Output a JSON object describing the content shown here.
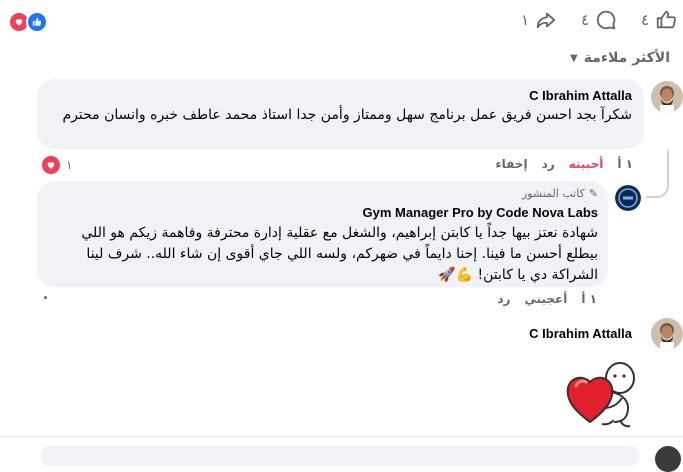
{
  "colors": {
    "brand": "#1877f2",
    "love": "#f33e58",
    "muted": "#65676b",
    "bubble": "#f0f2f5"
  },
  "action_bar": {
    "like_count": "٤",
    "comment_count": "٤",
    "share_count": "١",
    "icons": [
      "thumbs-up-icon",
      "comment-icon",
      "share-icon"
    ],
    "reactions": [
      "like-reaction-icon",
      "love-reaction-icon"
    ]
  },
  "sort": {
    "label": "الأكثر ملاءمة"
  },
  "comments": [
    {
      "author": "C Ibrahim Attalla",
      "text": "شكرآ بجد احسن فريق عمل برنامج سهل وممتاز وأمن جدا استاذ محمد عاطف خبره وانسان محترم",
      "time": "١ أ",
      "love_label": "أحببته",
      "reply_label": "رد",
      "hide_label": "إخفاء",
      "reaction_count": "١"
    }
  ],
  "reply": {
    "badge": "كاتب المنشور",
    "author": "Gym Manager Pro by Code Nova Labs",
    "text": "شهادة نعتز بيها جداً يا كابتن إبراهيم، والشغل مع عقلية إدارة محترفة وفاهمة زيكم هو اللي بيطلع أحسن ما فينا. إحنا دايماً في ضهركم، ولسه اللي جاي أقوى إن شاء الله.. شرف لينا الشراكة دي يا كابتن! 💪🚀",
    "time": "١ أ",
    "like_label": "أعجبني",
    "reply_label": "رد"
  },
  "second_comment": {
    "author": "C Ibrahim Attalla",
    "sticker": "heart-hug-sticker"
  }
}
